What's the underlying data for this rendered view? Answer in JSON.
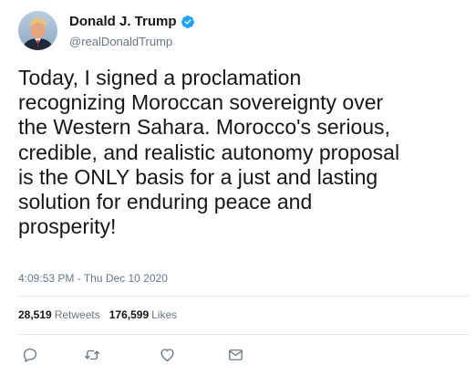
{
  "user": {
    "display_name": "Donald J. Trump",
    "handle": "@realDonaldTrump",
    "verified": true,
    "verified_color": "#1da1f2"
  },
  "tweet": {
    "text": "Today, I signed a proclamation\nrecognizing Moroccan sovereignty over\nthe Western Sahara.  Morocco's serious,\ncredible, and realistic autonomy proposal\nis the ONLY basis for a just and lasting\nsolution for enduring peace and\nprosperity!",
    "timestamp": "4:09:53 PM - Thu Dec 10 2020"
  },
  "stats": {
    "retweets_count": "28,519",
    "retweets_label": "Retweets",
    "likes_count": "176,599",
    "likes_label": "Likes"
  },
  "actions": {
    "icons": [
      "reply-icon",
      "retweet-icon",
      "like-icon",
      "direct-message-icon"
    ],
    "icon_color": "#657786"
  }
}
